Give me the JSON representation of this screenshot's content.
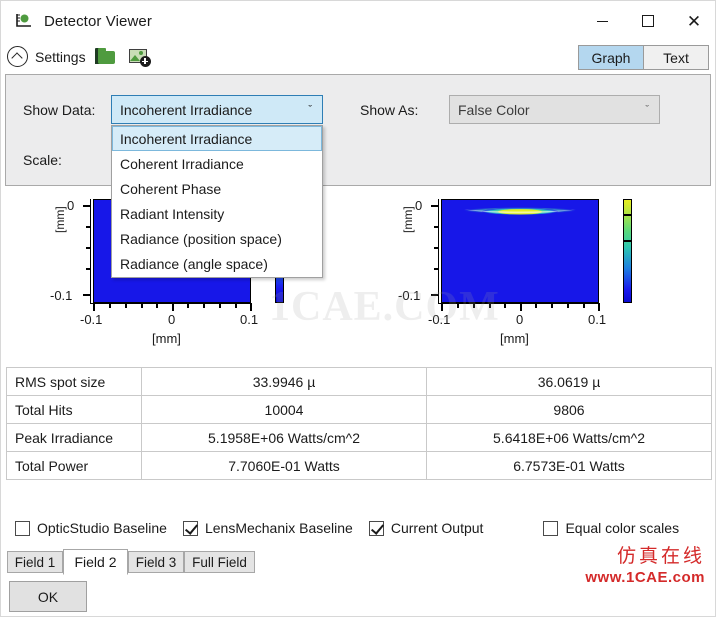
{
  "window": {
    "title": "Detector Viewer",
    "icon": "detector-plot-icon",
    "minimize_label": "—",
    "maximize_label": "□",
    "close_label": "✕"
  },
  "toolbar": {
    "collapse_icon": "chevron-up-circle-icon",
    "settings_label": "Settings",
    "open_folder_icon": "open-folder-icon",
    "save_image_icon": "add-image-icon",
    "view_modes": [
      {
        "label": "Graph",
        "active": true
      },
      {
        "label": "Text",
        "active": false
      }
    ]
  },
  "settings": {
    "show_data_label": "Show Data:",
    "show_data_value": "Incoherent Irradiance",
    "show_data_open": true,
    "show_data_options": [
      "Incoherent Irradiance",
      "Coherent Irradiance",
      "Coherent Phase",
      "Radiant Intensity",
      "Radiance (position space)",
      "Radiance (angle space)"
    ],
    "show_data_selected_index": 0,
    "scale_label": "Scale:",
    "show_as_label": "Show As:",
    "show_as_value": "False Color",
    "show_as_enabled": false,
    "dropdown_arrow_glyph": "ˇ"
  },
  "chart_data": [
    {
      "type": "heatmap",
      "name": "left-detector-plot",
      "title": "",
      "xlabel": "[mm]",
      "ylabel": "[mm]",
      "xticks": [
        "-0.1",
        "0",
        "0.1"
      ],
      "yticks": [
        "0",
        "-0.1"
      ],
      "xlim": [
        -0.1,
        0.1
      ],
      "ylim": [
        -0.1,
        0.1
      ],
      "colormap": "jet",
      "background_value_color": "#1717e8",
      "colorbar": {
        "min_color": "#0b0bd2",
        "max_color": "#e8ee1f",
        "ticks": 2
      },
      "grid": false,
      "note": "largely occluded by open dropdown list"
    },
    {
      "type": "heatmap",
      "name": "right-detector-plot",
      "title": "",
      "xlabel": "[mm]",
      "ylabel": "[mm]",
      "xticks": [
        "-0.1",
        "0",
        "0.1"
      ],
      "yticks": [
        "0",
        "-0.1"
      ],
      "xlim": [
        -0.1,
        0.1
      ],
      "ylim": [
        -0.1,
        0.1
      ],
      "colormap": "jet",
      "background_value_color": "#1717e8",
      "spot": {
        "shape": "thin-horizontal-lens-streak",
        "center_x": 0.0,
        "center_y": 0.0,
        "half_width_mm": 0.07,
        "half_height_mm": 0.006,
        "peak_color": "#e8ee1f"
      },
      "colorbar": {
        "min_color": "#0b0bd2",
        "max_color": "#e8ee1f",
        "ticks": 2
      },
      "grid": false
    }
  ],
  "results_table": {
    "rows": [
      {
        "label": "RMS spot size",
        "col1": "33.9946 µ",
        "col2": "36.0619 µ"
      },
      {
        "label": "Total Hits",
        "col1": "10004",
        "col2": "9806"
      },
      {
        "label": "Peak Irradiance",
        "col1": "5.1958E+06 Watts/cm^2",
        "col2": "5.6418E+06 Watts/cm^2"
      },
      {
        "label": "Total Power",
        "col1": "7.7060E-01 Watts",
        "col2": "6.7573E-01 Watts"
      }
    ]
  },
  "checkboxes": [
    {
      "label": "OpticStudio Baseline",
      "checked": false
    },
    {
      "label": "LensMechanix Baseline",
      "checked": true
    },
    {
      "label": "Current Output",
      "checked": true
    },
    {
      "label": "Equal color scales",
      "checked": false
    }
  ],
  "field_tabs": [
    {
      "label": "Field 1",
      "active": false
    },
    {
      "label": "Field 2",
      "active": true
    },
    {
      "label": "Field 3",
      "active": false
    },
    {
      "label": "Full Field",
      "active": false
    }
  ],
  "ok_button": "OK",
  "watermarks": {
    "center": "1CAE.COM",
    "chinese": "仿真在线",
    "url": "www.1CAE.com"
  }
}
